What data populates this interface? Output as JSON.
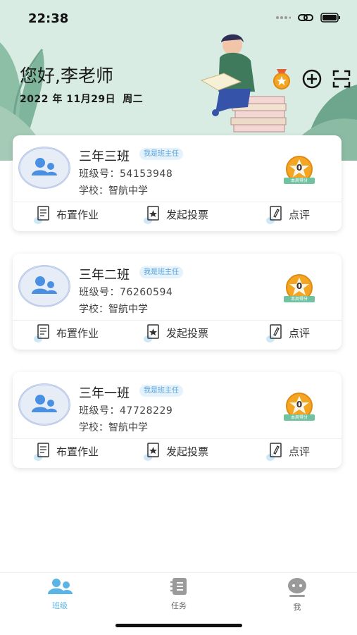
{
  "status_bar": {
    "time": "22:38"
  },
  "header": {
    "greeting": "您好,李老师",
    "date": "2022 年 11月29日",
    "weekday": "周二"
  },
  "classes": [
    {
      "name": "三年三班",
      "role_badge": "我是班主任",
      "class_no": "班级号：54153948",
      "school": "学校：智航中学",
      "score": "0",
      "score_label": "本周得分"
    },
    {
      "name": "三年二班",
      "role_badge": "我是班主任",
      "class_no": "班级号：76260594",
      "school": "学校：智航中学",
      "score": "0",
      "score_label": "本周得分"
    },
    {
      "name": "三年一班",
      "role_badge": "我是班主任",
      "class_no": "班级号：47728229",
      "school": "学校：智航中学",
      "score": "0",
      "score_label": "本周得分"
    }
  ],
  "actions": {
    "assign_homework": "布置作业",
    "start_vote": "发起投票",
    "comment": "点评"
  },
  "tabbar": {
    "items": [
      {
        "label": "班级",
        "active": true
      },
      {
        "label": "任务",
        "active": false
      },
      {
        "label": "我",
        "active": false
      }
    ]
  },
  "colors": {
    "accent": "#5ab4e6",
    "header_bg": "#d8ece4",
    "medal": "#f4a623"
  }
}
